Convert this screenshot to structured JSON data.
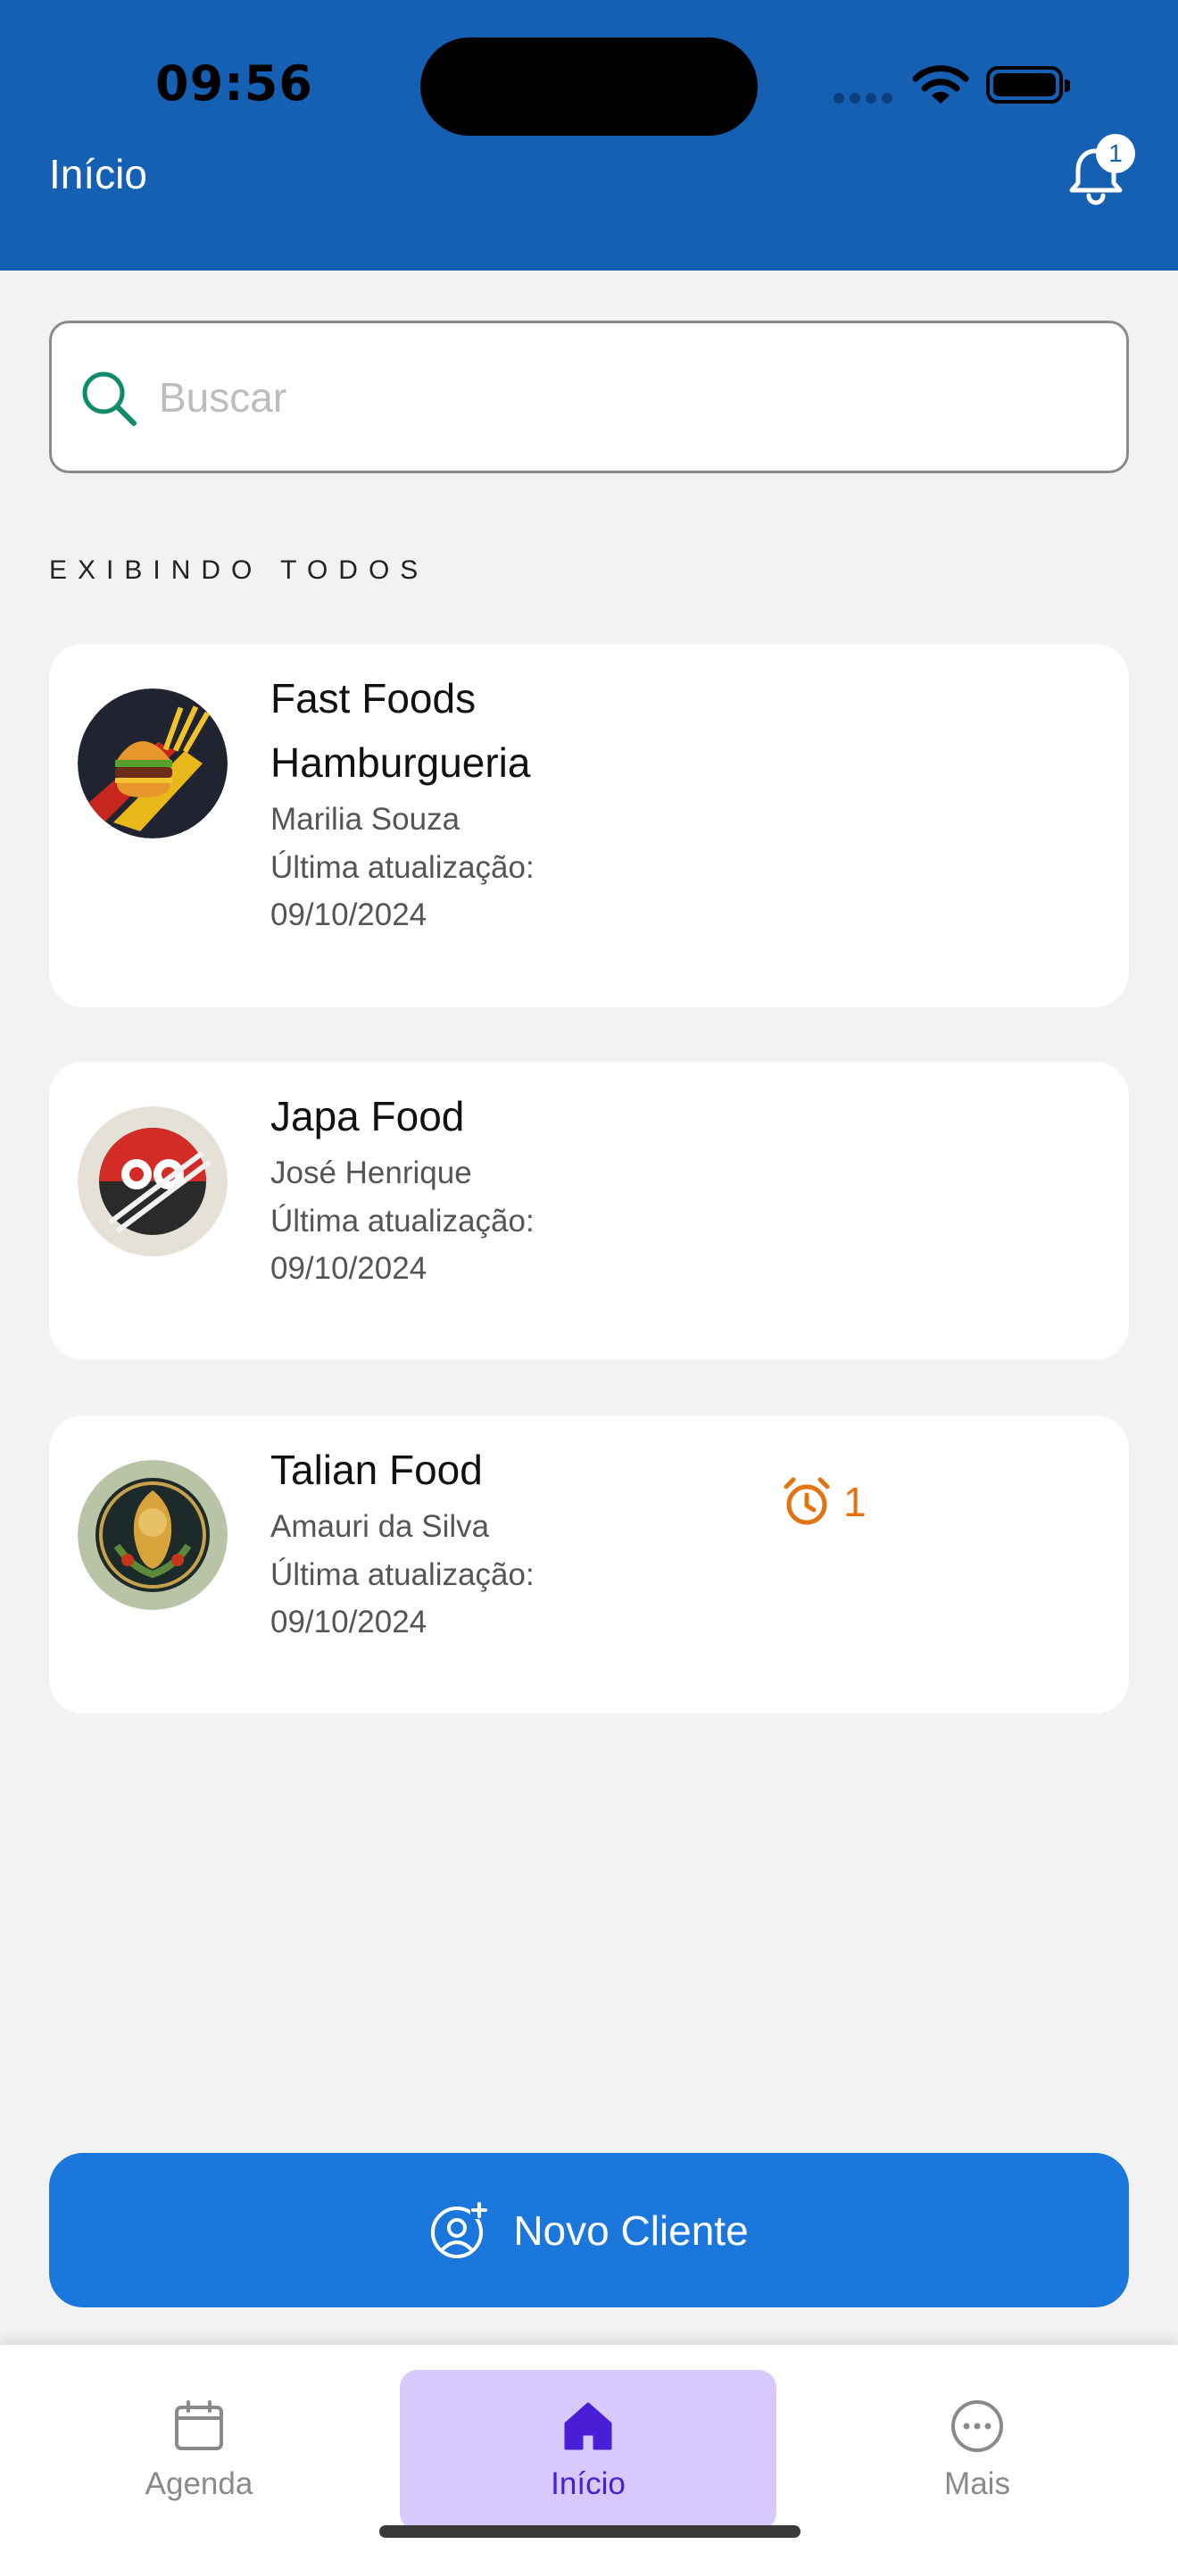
{
  "status_bar": {
    "time": "09:56"
  },
  "header": {
    "title": "Início",
    "notification_count": "1"
  },
  "search": {
    "placeholder": "Buscar",
    "value": ""
  },
  "section_label": "EXIBINDO TODOS",
  "clients": [
    {
      "name_line1": "Fast Foods",
      "name_line2": "Hamburgueria",
      "contact": "Marilia Souza",
      "updated_label": "Última atualização:",
      "updated_date": "09/10/2024"
    },
    {
      "name_line1": "Japa Food",
      "contact": "José Henrique",
      "updated_label": "Última atualização:",
      "updated_date": "09/10/2024"
    },
    {
      "name_line1": "Talian Food",
      "contact": "Amauri da Silva",
      "updated_label": "Última atualização:",
      "updated_date": "09/10/2024",
      "alarm_count": "1"
    }
  ],
  "new_client_button": {
    "label": "Novo Cliente"
  },
  "tabbar": {
    "items": [
      {
        "label": "Agenda",
        "icon": "calendar-icon"
      },
      {
        "label": "Início",
        "icon": "home-icon",
        "active": true
      },
      {
        "label": "Mais",
        "icon": "more-icon"
      }
    ]
  },
  "colors": {
    "header": "#1660b4",
    "primary_button": "#1b77db",
    "alarm": "#e37412",
    "active_tab_bg": "#d7c9fb",
    "active_tab_fg": "#4a1dd6"
  }
}
